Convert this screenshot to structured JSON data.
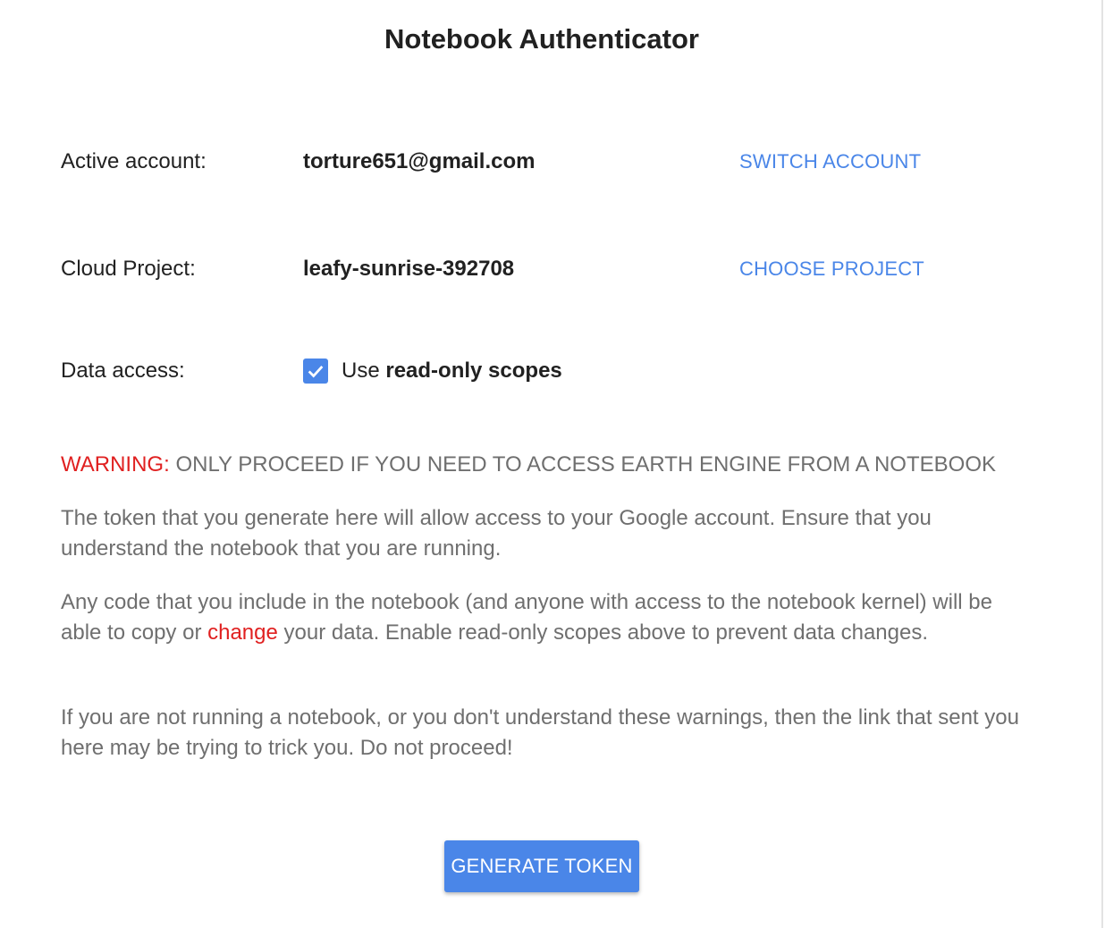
{
  "title": "Notebook Authenticator",
  "account": {
    "label": "Active account:",
    "value": "torture651@gmail.com",
    "action": "SWITCH ACCOUNT"
  },
  "project": {
    "label": "Cloud Project:",
    "value": "leafy-sunrise-392708",
    "action": "CHOOSE PROJECT"
  },
  "data_access": {
    "label": "Data access:",
    "checkbox_checked": true,
    "checkbox_prefix": "Use ",
    "checkbox_bold": "read-only scopes"
  },
  "warning": {
    "prefix": "WARNING:",
    "text": " ONLY PROCEED IF YOU NEED TO ACCESS EARTH ENGINE FROM A NOTEBOOK"
  },
  "paragraph1": "The token that you generate here will allow access to your Google account. Ensure that you understand the notebook that you are running.",
  "paragraph2": {
    "before": "Any code that you include in the notebook (and anyone with access to the notebook kernel) will be able to copy or ",
    "highlight": "change",
    "after": " your data. Enable read-only scopes above to prevent data changes."
  },
  "paragraph3": "If you are not running a notebook, or you don't understand these warnings, then the link that sent you here may be trying to trick you. Do not proceed!",
  "generate_button": "GENERATE TOKEN",
  "colors": {
    "accent": "#4a86e8",
    "warning": "#e02020",
    "body_text": "#6f6f6f",
    "heading_text": "#212121"
  }
}
